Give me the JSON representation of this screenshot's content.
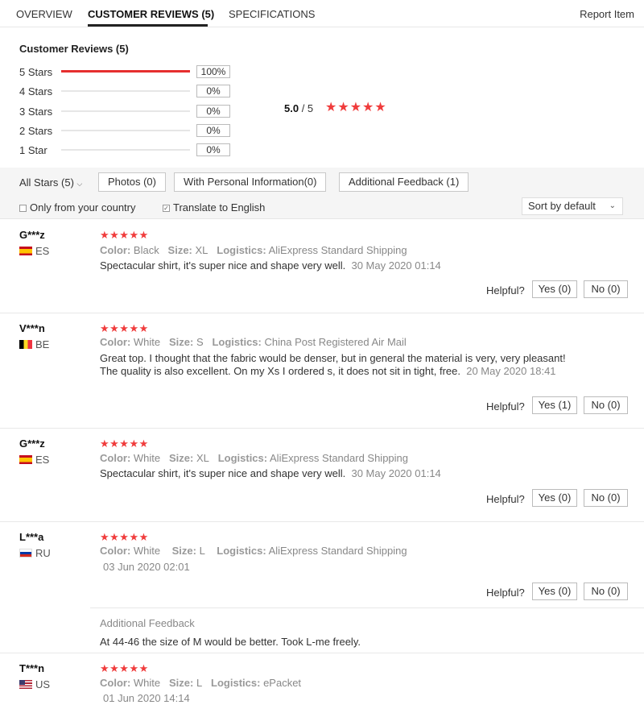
{
  "tabs": {
    "overview": "OVERVIEW",
    "reviews": "CUSTOMER REVIEWS (5)",
    "specifications": "SPECIFICATIONS",
    "report": "Report Item"
  },
  "summary": {
    "title": "Customer Reviews (5)",
    "rows": [
      {
        "label": "5 Stars",
        "pct": "100%",
        "fill": 1.0
      },
      {
        "label": "4 Stars",
        "pct": "0%",
        "fill": 0
      },
      {
        "label": "3 Stars",
        "pct": "0%",
        "fill": 0
      },
      {
        "label": "2 Stars",
        "pct": "0%",
        "fill": 0
      },
      {
        "label": "1 Star",
        "pct": "0%",
        "fill": 0
      }
    ],
    "avg": "5.0",
    "avg_of": "/ 5",
    "avg_stars": "★★★★★",
    "star_color": "#f03c3c"
  },
  "filters": {
    "all_stars": "All Stars (5)",
    "photos": "Photos (0)",
    "personal": "With Personal Information(0)",
    "additional": "Additional Feedback (1)",
    "only_country": "Only from your country",
    "translate": "Translate to English",
    "sort": "Sort by default"
  },
  "reviews": [
    {
      "name": "G***z",
      "country": "ES",
      "flag": "es",
      "stars": "★★★★★",
      "color_label": "Color:",
      "color": "Black",
      "size_label": "Size:",
      "size": "XL",
      "logistics_label": "Logistics:",
      "logistics": "AliExpress Standard Shipping",
      "text": "Spectacular shirt, it's super nice and shape very well.",
      "date": "30 May 2020 01:14",
      "helpful": "Helpful?",
      "yes": "Yes (0)",
      "no": "No (0)"
    },
    {
      "name": "V***n",
      "country": "BE",
      "flag": "be",
      "stars": "★★★★★",
      "color_label": "Color:",
      "color": "White",
      "size_label": "Size:",
      "size": "S",
      "logistics_label": "Logistics:",
      "logistics": "China Post Registered Air Mail",
      "text": "Great top. I thought that the fabric would be denser, but in general the material is very, very pleasant! The quality is also excellent. On my Xs I ordered s, it does not sit in tight, free.",
      "date": "20 May 2020 18:41",
      "helpful": "Helpful?",
      "yes": "Yes (1)",
      "no": "No (0)"
    },
    {
      "name": "G***z",
      "country": "ES",
      "flag": "es",
      "stars": "★★★★★",
      "color_label": "Color:",
      "color": "White",
      "size_label": "Size:",
      "size": "XL",
      "logistics_label": "Logistics:",
      "logistics": "AliExpress Standard Shipping",
      "text": "Spectacular shirt, it's super nice and shape very well.",
      "date": "30 May 2020 01:14",
      "helpful": "Helpful?",
      "yes": "Yes (0)",
      "no": "No (0)"
    },
    {
      "name": "L***a",
      "country": "RU",
      "flag": "ru",
      "stars": "★★★★★",
      "color_label": "Color:",
      "color": "White",
      "size_label": "Size:",
      "size": "L",
      "logistics_label": "Logistics:",
      "logistics": "AliExpress Standard Shipping",
      "date": "03 Jun 2020 02:01",
      "helpful": "Helpful?",
      "yes": "Yes (0)",
      "no": "No (0)",
      "additional_title": "Additional Feedback",
      "additional_text": "At 44-46 the size of M would be better. Took L-me freely."
    },
    {
      "name": "T***n",
      "country": "US",
      "flag": "us",
      "stars": "★★★★★",
      "color_label": "Color:",
      "color": "White",
      "size_label": "Size:",
      "size": "L",
      "logistics_label": "Logistics:",
      "logistics": "ePacket",
      "date": "01 Jun 2020 14:14"
    }
  ]
}
